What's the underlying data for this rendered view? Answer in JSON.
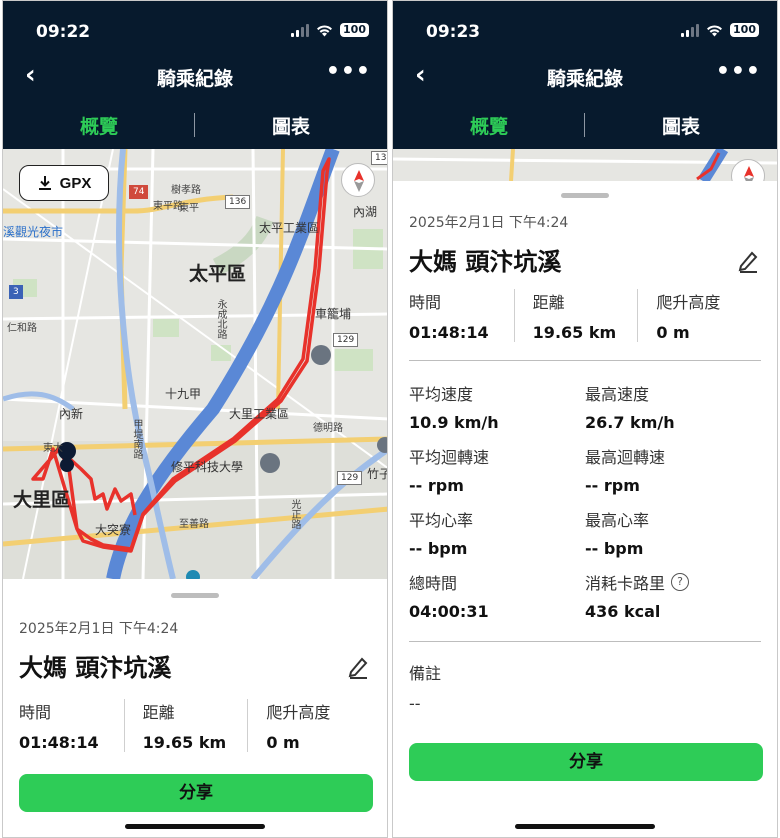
{
  "left": {
    "status": {
      "time": "09:22",
      "battery": "100"
    },
    "nav": {
      "title": "騎乘紀錄",
      "more": "•••"
    },
    "tabs": [
      {
        "label": "概覽"
      },
      {
        "label": "圖表"
      }
    ],
    "map": {
      "gpx_label": "GPX",
      "labels": {
        "taiping": "太平區",
        "dali": "大里區",
        "taiping_industrial": "太平工業區",
        "dali_industrial": "大里工業區",
        "shiujiu_jia": "十九甲",
        "neixin": "內新",
        "chechongbu": "車籠埔",
        "dezhao": "德明路",
        "neihu": "內湖",
        "night_market": "溪觀光夜市",
        "xiuping": "修平科技大學",
        "datuzhai": "大突寮",
        "zhuzi": "竹子",
        "shuhu": "樹孝路",
        "dongping": "東平路",
        "renhe": "仁和路",
        "jiapin": "甲堤南路",
        "yongcheng": "永成北路",
        "zhishan": "至善路",
        "guangzheng": "光正路",
        "dongping2": "東平",
        "road136": "136",
        "road74": "74",
        "road129": "129",
        "road3": "3",
        "road129b": "129",
        "road136b": "136",
        "dongda": "東大"
      }
    },
    "ride": {
      "date": "2025年2月1日 下午4:24",
      "name": "大媽 頭汴坑溪",
      "time_label": "時間",
      "time_value": "01:48:14",
      "distance_label": "距離",
      "distance_value": "19.65 km",
      "climb_label": "爬升高度",
      "climb_value": "0 m"
    },
    "share_label": "分享"
  },
  "right": {
    "status": {
      "time": "09:23",
      "battery": "100"
    },
    "nav": {
      "title": "騎乘紀錄",
      "more": "•••"
    },
    "tabs": [
      {
        "label": "概覽"
      },
      {
        "label": "圖表"
      }
    ],
    "ride": {
      "date": "2025年2月1日 下午4:24",
      "name": "大媽 頭汴坑溪",
      "time_label": "時間",
      "time_value": "01:48:14",
      "distance_label": "距離",
      "distance_value": "19.65 km",
      "climb_label": "爬升高度",
      "climb_value": "0 m"
    },
    "details": [
      {
        "label": "平均速度",
        "value": "10.9 km/h"
      },
      {
        "label": "最高速度",
        "value": "26.7 km/h"
      },
      {
        "label": "平均迴轉速",
        "value": "-- rpm"
      },
      {
        "label": "最高迴轉速",
        "value": "-- rpm"
      },
      {
        "label": "平均心率",
        "value": "-- bpm"
      },
      {
        "label": "最高心率",
        "value": "-- bpm"
      },
      {
        "label": "總時間",
        "value": "04:00:31"
      },
      {
        "label": "消耗卡路里",
        "value": "436 kcal"
      }
    ],
    "notes_label": "備註",
    "notes_value": "--",
    "share_label": "分享"
  },
  "colors": {
    "accent": "#2ecc57",
    "header": "#071a2d",
    "route": "#e8322b",
    "river": "#5a88d6"
  }
}
